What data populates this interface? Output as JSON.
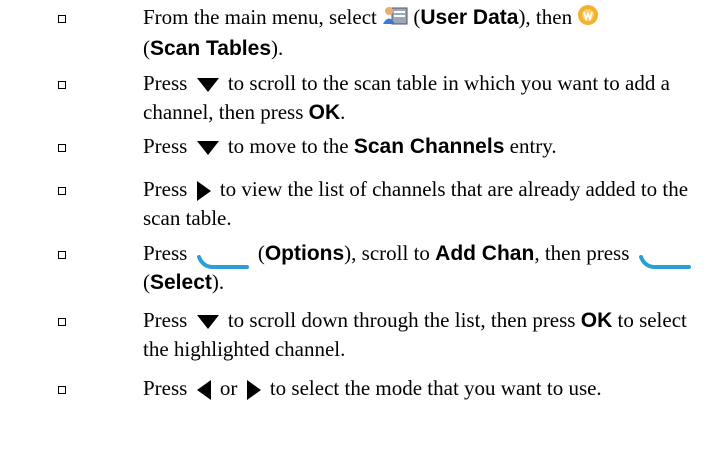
{
  "steps": [
    {
      "press": "From the main menu, select",
      "icon1": "user-data-icon",
      "label1": "User Data",
      "mid": "), then",
      "icon2": "scan-tables-icon",
      "label2": "Scan Tables",
      "end": ")."
    },
    {
      "press": "Press",
      "icon": "down-arrow-key",
      "rest": "to scroll to the scan table in which you want to add a channel, then press",
      "key": "OK",
      "end": "."
    },
    {
      "press": "Press",
      "icon": "down-arrow-key",
      "rest": "to move to the",
      "key": "Scan Channels",
      "end": "entry."
    },
    {
      "press": "Press",
      "icon": "right-arrow-key",
      "rest": "to view the list of channels that are already added to the scan table."
    },
    {
      "press": "Press",
      "icon": "left-softkey",
      "label1": "Options",
      "mid": "), scroll to",
      "key": "Add Chan",
      "mid2": ", then press",
      "icon2": "left-softkey",
      "label2": "Select",
      "end": ")."
    },
    {
      "press": "Press",
      "icon": "down-arrow-key",
      "rest": "to scroll down through the list, then press",
      "key": "OK",
      "end": "to select the highlighted channel."
    },
    {
      "press": "Press",
      "icon": "left-arrow-key",
      "or": "or",
      "icon2": "right-arrow-key",
      "rest": "to select the mode that you want to use."
    }
  ],
  "colors": {
    "softkey": "#2a9fd6",
    "scan_icon": "#f0a020"
  }
}
